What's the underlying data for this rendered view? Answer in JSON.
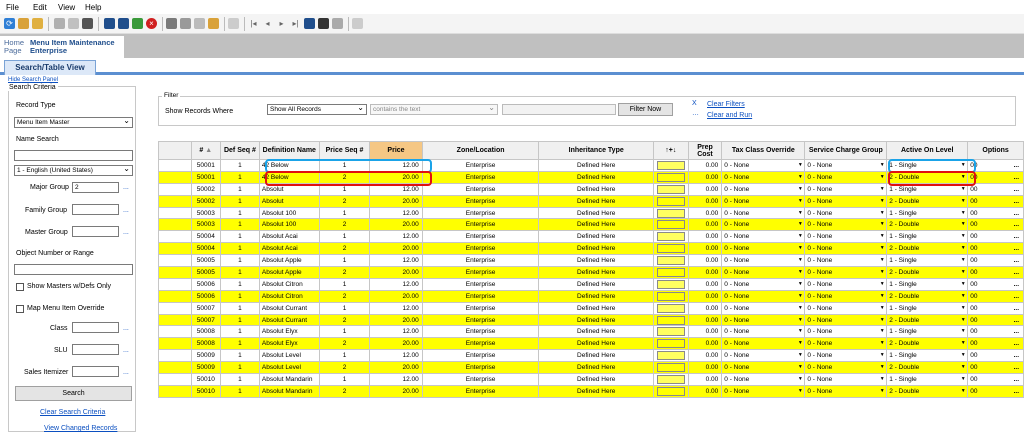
{
  "menu": [
    "File",
    "Edit",
    "View",
    "Help"
  ],
  "nav": {
    "home": "Home Page",
    "title_line1": "Menu Item Maintenance",
    "title_line2": "Enterprise"
  },
  "tab": "Search/Table View",
  "hide_search": "Hide Search Panel",
  "search": {
    "legend": "Search Criteria",
    "record_type_label": "Record Type",
    "record_type_value": "Menu Item Master",
    "name_search_label": "Name Search",
    "language_value": "1 - English (United States)",
    "major_group_label": "Major Group",
    "major_group_value": "2",
    "family_group_label": "Family Group",
    "master_group_label": "Master Group",
    "object_range_label": "Object Number or Range",
    "show_masters_label": "Show Masters w/Defs Only",
    "map_override_label": "Map Menu Item Override",
    "class_label": "Class",
    "slu_label": "SLU",
    "sales_itemizer_label": "Sales Itemizer",
    "search_button": "Search",
    "clear_link": "Clear Search Criteria",
    "view_changed_link": "View Changed Records",
    "dots": "..."
  },
  "filter": {
    "legend": "Filter",
    "show_records_label": "Show Records Where",
    "field_value": "Show All Records",
    "op_value": "contains the text",
    "filter_button": "Filter Now",
    "clear_filters": "Clear Filters",
    "clear_and_run": "Clear and Run"
  },
  "grid": {
    "headers": [
      "#",
      "Def Seq #",
      "Definition Name",
      "Price Seq #",
      "Price",
      "Zone/Location",
      "Inheritance Type",
      "↑+↓",
      "Prep Cost",
      "Tax Class Override",
      "Service Charge Group",
      "Active On Level",
      "Options"
    ],
    "rows": [
      {
        "num": "50001",
        "def": "1",
        "name": "42 Below",
        "pseq": "1",
        "price": "12.00",
        "zone": "Enterprise",
        "inh": "Defined Here",
        "prep": "0.00",
        "tax": "0 - None",
        "svc": "0 - None",
        "level": "1 - Single",
        "opt": "00"
      },
      {
        "num": "50001",
        "def": "1",
        "name": "42 Below",
        "pseq": "2",
        "price": "20.00",
        "zone": "Enterprise",
        "inh": "Defined Here",
        "prep": "0.00",
        "tax": "0 - None",
        "svc": "0 - None",
        "level": "2 - Double",
        "opt": "00"
      },
      {
        "num": "50002",
        "def": "1",
        "name": "Absolut",
        "pseq": "1",
        "price": "12.00",
        "zone": "Enterprise",
        "inh": "Defined Here",
        "prep": "0.00",
        "tax": "0 - None",
        "svc": "0 - None",
        "level": "1 - Single",
        "opt": "00"
      },
      {
        "num": "50002",
        "def": "1",
        "name": "Absolut",
        "pseq": "2",
        "price": "20.00",
        "zone": "Enterprise",
        "inh": "Defined Here",
        "prep": "0.00",
        "tax": "0 - None",
        "svc": "0 - None",
        "level": "2 - Double",
        "opt": "00"
      },
      {
        "num": "50003",
        "def": "1",
        "name": "Absolut 100",
        "pseq": "1",
        "price": "12.00",
        "zone": "Enterprise",
        "inh": "Defined Here",
        "prep": "0.00",
        "tax": "0 - None",
        "svc": "0 - None",
        "level": "1 - Single",
        "opt": "00"
      },
      {
        "num": "50003",
        "def": "1",
        "name": "Absolut 100",
        "pseq": "2",
        "price": "20.00",
        "zone": "Enterprise",
        "inh": "Defined Here",
        "prep": "0.00",
        "tax": "0 - None",
        "svc": "0 - None",
        "level": "2 - Double",
        "opt": "00"
      },
      {
        "num": "50004",
        "def": "1",
        "name": "Absolut Acai",
        "pseq": "1",
        "price": "12.00",
        "zone": "Enterprise",
        "inh": "Defined Here",
        "prep": "0.00",
        "tax": "0 - None",
        "svc": "0 - None",
        "level": "1 - Single",
        "opt": "00"
      },
      {
        "num": "50004",
        "def": "1",
        "name": "Absolut Acai",
        "pseq": "2",
        "price": "20.00",
        "zone": "Enterprise",
        "inh": "Defined Here",
        "prep": "0.00",
        "tax": "0 - None",
        "svc": "0 - None",
        "level": "2 - Double",
        "opt": "00"
      },
      {
        "num": "50005",
        "def": "1",
        "name": "Absolut Apple",
        "pseq": "1",
        "price": "12.00",
        "zone": "Enterprise",
        "inh": "Defined Here",
        "prep": "0.00",
        "tax": "0 - None",
        "svc": "0 - None",
        "level": "1 - Single",
        "opt": "00"
      },
      {
        "num": "50005",
        "def": "1",
        "name": "Absolut Apple",
        "pseq": "2",
        "price": "20.00",
        "zone": "Enterprise",
        "inh": "Defined Here",
        "prep": "0.00",
        "tax": "0 - None",
        "svc": "0 - None",
        "level": "2 - Double",
        "opt": "00"
      },
      {
        "num": "50006",
        "def": "1",
        "name": "Absolut Citron",
        "pseq": "1",
        "price": "12.00",
        "zone": "Enterprise",
        "inh": "Defined Here",
        "prep": "0.00",
        "tax": "0 - None",
        "svc": "0 - None",
        "level": "1 - Single",
        "opt": "00"
      },
      {
        "num": "50006",
        "def": "1",
        "name": "Absolut Citron",
        "pseq": "2",
        "price": "20.00",
        "zone": "Enterprise",
        "inh": "Defined Here",
        "prep": "0.00",
        "tax": "0 - None",
        "svc": "0 - None",
        "level": "2 - Double",
        "opt": "00"
      },
      {
        "num": "50007",
        "def": "1",
        "name": "Absolut Currant",
        "pseq": "1",
        "price": "12.00",
        "zone": "Enterprise",
        "inh": "Defined Here",
        "prep": "0.00",
        "tax": "0 - None",
        "svc": "0 - None",
        "level": "1 - Single",
        "opt": "00"
      },
      {
        "num": "50007",
        "def": "1",
        "name": "Absolut Currant",
        "pseq": "2",
        "price": "20.00",
        "zone": "Enterprise",
        "inh": "Defined Here",
        "prep": "0.00",
        "tax": "0 - None",
        "svc": "0 - None",
        "level": "2 - Double",
        "opt": "00"
      },
      {
        "num": "50008",
        "def": "1",
        "name": "Absolut Elyx",
        "pseq": "1",
        "price": "12.00",
        "zone": "Enterprise",
        "inh": "Defined Here",
        "prep": "0.00",
        "tax": "0 - None",
        "svc": "0 - None",
        "level": "1 - Single",
        "opt": "00"
      },
      {
        "num": "50008",
        "def": "1",
        "name": "Absolut Elyx",
        "pseq": "2",
        "price": "20.00",
        "zone": "Enterprise",
        "inh": "Defined Here",
        "prep": "0.00",
        "tax": "0 - None",
        "svc": "0 - None",
        "level": "2 - Double",
        "opt": "00"
      },
      {
        "num": "50009",
        "def": "1",
        "name": "Absolut Level",
        "pseq": "1",
        "price": "12.00",
        "zone": "Enterprise",
        "inh": "Defined Here",
        "prep": "0.00",
        "tax": "0 - None",
        "svc": "0 - None",
        "level": "1 - Single",
        "opt": "00"
      },
      {
        "num": "50009",
        "def": "1",
        "name": "Absolut Level",
        "pseq": "2",
        "price": "20.00",
        "zone": "Enterprise",
        "inh": "Defined Here",
        "prep": "0.00",
        "tax": "0 - None",
        "svc": "0 - None",
        "level": "2 - Double",
        "opt": "00"
      },
      {
        "num": "50010",
        "def": "1",
        "name": "Absolut Mandarin",
        "pseq": "1",
        "price": "12.00",
        "zone": "Enterprise",
        "inh": "Defined Here",
        "prep": "0.00",
        "tax": "0 - None",
        "svc": "0 - None",
        "level": "1 - Single",
        "opt": "00"
      },
      {
        "num": "50010",
        "def": "1",
        "name": "Absolut Mandarin",
        "pseq": "2",
        "price": "20.00",
        "zone": "Enterprise",
        "inh": "Defined Here",
        "prep": "0.00",
        "tax": "0 - None",
        "svc": "0 - None",
        "level": "2 - Double",
        "opt": "00"
      }
    ],
    "options_dots": "..."
  },
  "colors": {
    "highlight_blue": "#1aa3e8",
    "highlight_red": "#e01010",
    "row_yellow": "#ffff00",
    "price_header": "#f5c784"
  }
}
